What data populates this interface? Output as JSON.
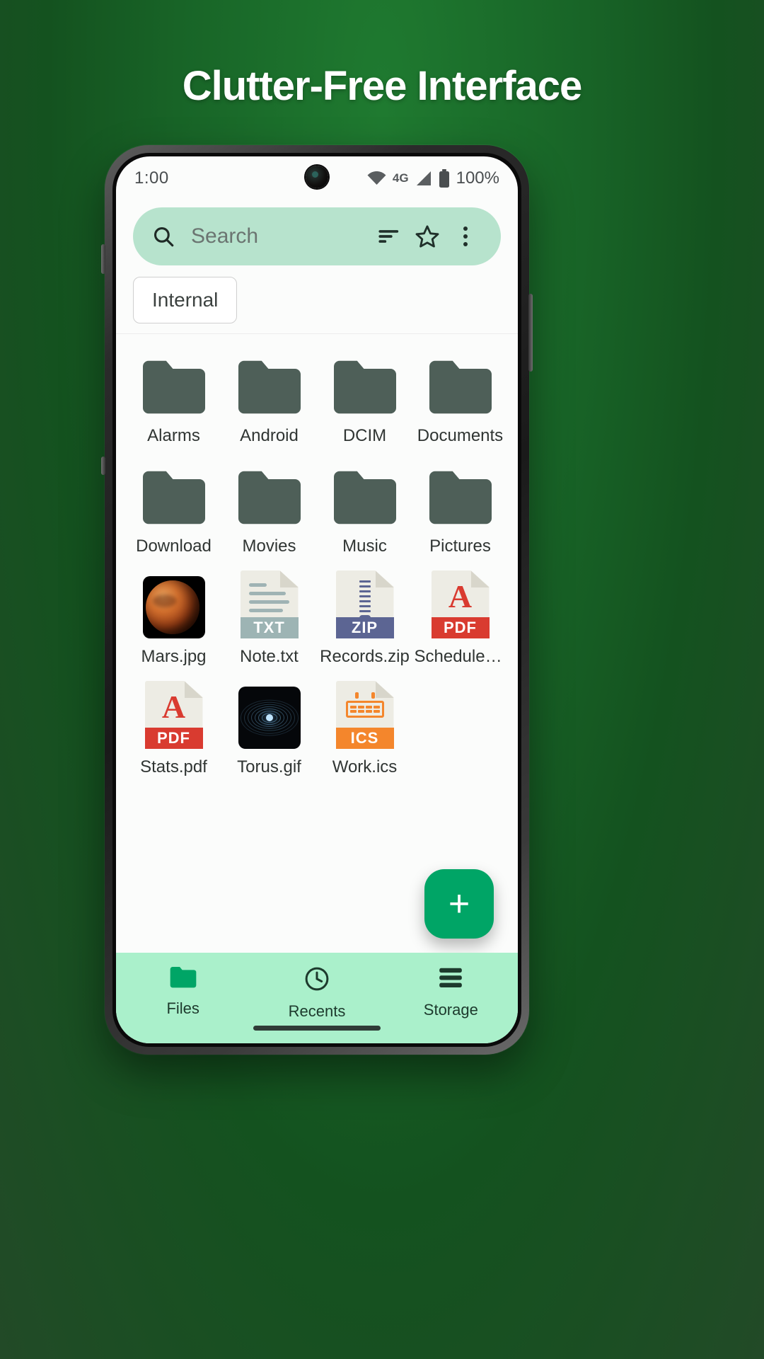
{
  "headline": "Clutter-Free Interface",
  "theme": {
    "bg_green": "#186427",
    "accent": "#00a566",
    "searchbar_bg": "#b7e3cd",
    "navbar_bg": "#aaf0cb",
    "folder_color": "#4e5f58"
  },
  "status_bar": {
    "time": "1:00",
    "network": "4G",
    "battery": "100%",
    "wifi_icon": "wifi-icon",
    "signal_icon": "signal-icon",
    "battery_icon": "battery-icon",
    "camera": "front-camera-punch-hole"
  },
  "search": {
    "placeholder": "Search",
    "value": "",
    "search_icon": "search-icon",
    "sort_icon": "sort-icon",
    "star_icon": "star-icon",
    "overflow_icon": "more-vertical-icon"
  },
  "tabs": [
    {
      "label": "Internal",
      "selected": true
    }
  ],
  "files": [
    {
      "name": "Alarms",
      "kind": "folder"
    },
    {
      "name": "Android",
      "kind": "folder"
    },
    {
      "name": "DCIM",
      "kind": "folder"
    },
    {
      "name": "Documents",
      "kind": "folder"
    },
    {
      "name": "Download",
      "kind": "folder"
    },
    {
      "name": "Movies",
      "kind": "folder"
    },
    {
      "name": "Music",
      "kind": "folder"
    },
    {
      "name": "Pictures",
      "kind": "folder"
    },
    {
      "name": "Mars.jpg",
      "kind": "image"
    },
    {
      "name": "Note.txt",
      "kind": "doc",
      "badge": "TXT",
      "badge_color": "#9db4b4"
    },
    {
      "name": "Records.zip",
      "kind": "zip",
      "badge": "ZIP",
      "badge_color": "#5c6593"
    },
    {
      "name": "Schedule.pdf",
      "kind": "pdf",
      "badge": "PDF",
      "badge_color": "#d93b30"
    },
    {
      "name": "Stats.pdf",
      "kind": "pdf",
      "badge": "PDF",
      "badge_color": "#d93b30"
    },
    {
      "name": "Torus.gif",
      "kind": "gif"
    },
    {
      "name": "Work.ics",
      "kind": "ics",
      "badge": "ICS",
      "badge_color": "#f4862c"
    }
  ],
  "fab": {
    "label": "+",
    "name": "add-button"
  },
  "bottom_nav": [
    {
      "label": "Files",
      "icon": "folder-icon",
      "selected": true
    },
    {
      "label": "Recents",
      "icon": "clock-icon",
      "selected": false
    },
    {
      "label": "Storage",
      "icon": "storage-icon",
      "selected": false
    }
  ]
}
